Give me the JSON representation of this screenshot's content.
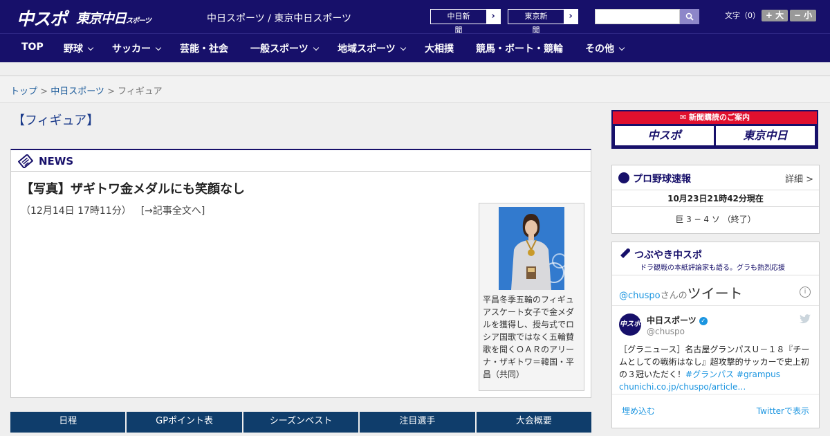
{
  "header": {
    "logo_main": "中スポ",
    "logo_tokyo": "東京中日",
    "logo_tokyo_suffix": "スポーツ",
    "site_links": "中日スポーツ / 東京中日スポーツ",
    "paper_buttons": [
      {
        "label": "中日新聞"
      },
      {
        "label": "東京新聞"
      }
    ],
    "search_placeholder": "",
    "font_size_label": "文字（0）",
    "font_plus": "+ 大",
    "font_minus": "− 小"
  },
  "nav": {
    "items": [
      {
        "label": "TOP"
      },
      {
        "label": "野球"
      },
      {
        "label": "サッカー"
      },
      {
        "label": "芸能・社会"
      },
      {
        "label": "一般スポーツ"
      },
      {
        "label": "地域スポーツ"
      },
      {
        "label": "大相撲"
      },
      {
        "label": "競馬・ボート・競輪"
      },
      {
        "label": "その他"
      }
    ]
  },
  "breadcrumb": {
    "top": "トップ",
    "sep": " > ",
    "section": "中日スポーツ",
    "current": "フィギュア"
  },
  "page_title": "【フィギュア】",
  "news": {
    "label": "NEWS",
    "article_title": "【写真】ザギトワ金メダルにも笑顔なし",
    "date": "（12月14日 17時11分）",
    "full_link": "[→記事全文へ]",
    "caption": "平昌冬季五輪のフィギュアスケート女子で金メダルを獲得し、授与式でロシア国歌ではなく五輪賛歌を聞くＯＡＲのアリーナ・ザギトワ＝韓国・平昌（共同）"
  },
  "tabs": [
    {
      "label": "日程"
    },
    {
      "label": "GPポイント表"
    },
    {
      "label": "シーズンベスト"
    },
    {
      "label": "注目選手"
    },
    {
      "label": "大会概要"
    }
  ],
  "sidebar": {
    "ad": {
      "title": "新聞購読のご案内",
      "btn1": "中スポ",
      "btn2": "東京中日"
    },
    "baseball": {
      "title": "プロ野球速報",
      "detail": "詳細 >",
      "time": "10月23日21時42分現在",
      "score": "巨 3 − 4 ソ （終了）"
    },
    "tweets": {
      "title": "つぶやき中スポ",
      "subtitle": "ドラ観戦の本紙評論家も語る。グラも熱烈応援",
      "handle": "@chuspo",
      "handle_suffix": "さんの",
      "tweet_word": "ツイート",
      "avatar_text": "中スポ",
      "name": "中日スポーツ",
      "username": "@chuspo",
      "text_main": "［グラニュース］名古屋グランパスＵ－１８『チームとしての戦術はなし』超攻撃的サッカーで史上初の３冠いただく！",
      "text_tags": "#グランパス #grampus",
      "text_link": "chunichi.co.jp/chuspo/article…",
      "embed": "埋め込む",
      "view": "Twitterで表示"
    }
  },
  "colors": {
    "brand_navy": "#17106a",
    "tab_blue": "#0f3d6b",
    "ad_red": "#e0102e",
    "link_blue": "#1b95e0"
  }
}
